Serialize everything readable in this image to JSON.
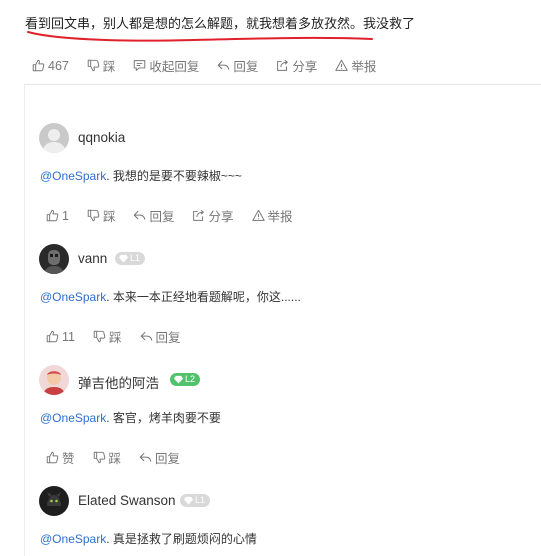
{
  "post": {
    "text": "看到回文串，别人都是想的怎么解题，就我想着多放孜然。我没救了",
    "actions": {
      "like": "467",
      "dislike": "踩",
      "collapse": "收起回复",
      "reply": "回复",
      "share": "分享",
      "report": "举报"
    }
  },
  "comments": [
    {
      "username": "qqnokia",
      "mention": "@OneSpark",
      "text": ". 我想的是要不要辣椒~~~",
      "actions": {
        "like": "1",
        "dislike": "踩",
        "reply": "回复",
        "share": "分享",
        "report": "举报"
      }
    },
    {
      "username": "vann",
      "level": "L1",
      "mention": "@OneSpark",
      "text": ". 本来一本正经地看题解呢，你这......",
      "actions": {
        "like": "11",
        "dislike": "踩",
        "reply": "回复"
      }
    },
    {
      "username": "弹吉他的阿浩",
      "level": "L2",
      "mention": "@OneSpark",
      "text": ". 客官，烤羊肉要不要",
      "actions": {
        "like": "赞",
        "dislike": "踩",
        "reply": "回复"
      }
    },
    {
      "username": "Elated Swanson",
      "level": "L1",
      "mention": "@OneSpark",
      "text": ". 真是拯救了刷题烦闷的心情"
    }
  ],
  "colors": {
    "mention": "#2e6fd1",
    "underline": "#e0202a",
    "level_green": "#53c26c",
    "level_grey": "#d9d9d9"
  }
}
